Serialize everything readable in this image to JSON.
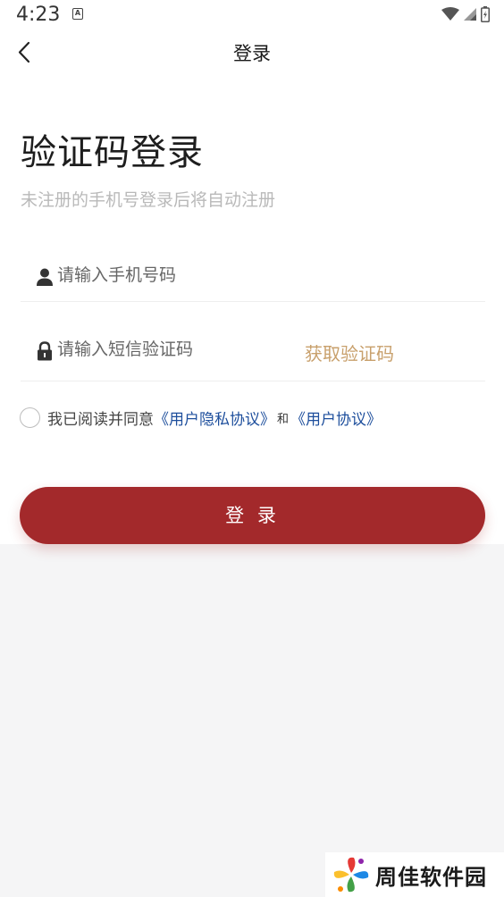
{
  "status_bar": {
    "time": "4:23",
    "notification_glyph": "A",
    "icons": [
      "wifi-icon",
      "signal-icon",
      "battery-icon"
    ]
  },
  "header": {
    "title": "登录",
    "back_icon": "chevron-left-icon"
  },
  "main": {
    "heading": "验证码登录",
    "subtitle": "未注册的手机号登录后将自动注册",
    "phone_field": {
      "placeholder": "请输入手机号码",
      "value": "",
      "icon": "user-icon"
    },
    "code_field": {
      "placeholder": "请输入短信验证码",
      "value": "",
      "icon": "lock-icon"
    },
    "get_code_label": "获取验证码",
    "agreement": {
      "prefix": "我已阅读并同意",
      "privacy_link": "《用户隐私协议》",
      "joiner": "和",
      "user_link": "《用户协议》",
      "checked": false
    },
    "login_button": "登 录"
  },
  "watermark": {
    "text": "周佳软件园"
  },
  "colors": {
    "primary": "#a3292b",
    "accent_gold": "#c8a06c",
    "link_blue": "#1d4e9c",
    "placeholder": "#b9b9b9"
  }
}
